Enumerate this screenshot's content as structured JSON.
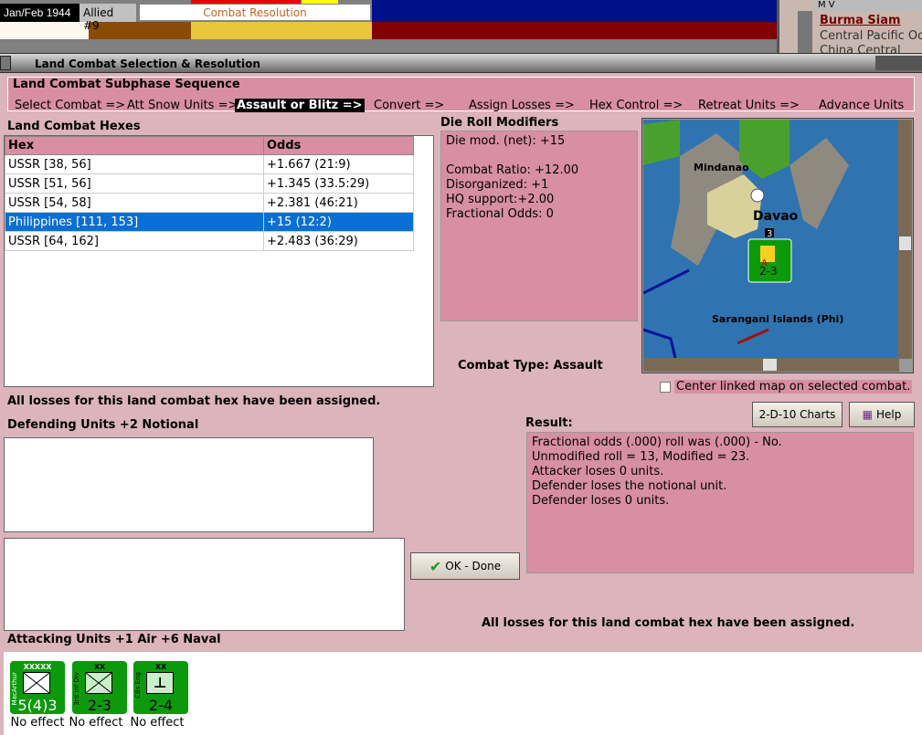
{
  "top": {
    "date": "Jan/Feb 1944",
    "side": "Allied #9",
    "phase": "Combat Resolution",
    "right_panel": {
      "header": "M V",
      "items": [
        "Burma Siam",
        "Central Pacific Oc",
        "China Central"
      ]
    }
  },
  "window": {
    "title": "Land Combat Selection & Resolution"
  },
  "sequence": {
    "title": "Land Combat Subphase Sequence",
    "items": [
      "Select Combat =>",
      "Att Snow Units =>",
      "Assault or Blitz =>",
      "Convert =>",
      "Assign Losses =>",
      "Hex Control =>",
      "Retreat Units =>",
      "Advance Units"
    ],
    "active_index": 2
  },
  "hexes": {
    "title": "Land Combat Hexes",
    "columns": [
      "Hex",
      "Odds"
    ],
    "rows": [
      [
        "USSR [38, 56]",
        "+1.667 (21:9)"
      ],
      [
        "USSR [51, 56]",
        "+1.345 (33.5:29)"
      ],
      [
        "USSR [54, 58]",
        "+2.381 (46:21)"
      ],
      [
        "Philippines [111, 153]",
        "+15 (12:2)"
      ],
      [
        "USSR [64, 162]",
        "+2.483 (36:29)"
      ]
    ],
    "selected_index": 3
  },
  "modifiers": {
    "title": "Die Roll Modifiers",
    "lines": [
      "Die mod. (net): +15",
      "",
      "Combat Ratio: +12.00",
      "Disorganized: +1",
      "HQ support:+2.00",
      "Fractional Odds: 0"
    ]
  },
  "map": {
    "labels": [
      "Mindanao",
      "Davao",
      "Sarangani Islands (Phi)"
    ],
    "unit_strength": "2-3",
    "stack_count": "3",
    "unit_marker": "A"
  },
  "combat_type": "Combat Type:  Assault",
  "center_checkbox": {
    "label": "Center linked map on selected combat.",
    "checked": false
  },
  "buttons": {
    "charts": "2-D-10 Charts",
    "help": "Help",
    "ok": "OK - Done"
  },
  "losses_msg": "All losses for this land combat hex have been assigned.",
  "defending": {
    "title": "Defending Units +2 Notional"
  },
  "result": {
    "title": "Result:",
    "lines": [
      "Fractional odds (.000) roll was (.000)  - No.",
      "Unmodified roll = 13, Modified = 23.",
      "Attacker loses 0 units.",
      "Defender loses the notional unit.",
      "Defender loses 0 units."
    ]
  },
  "attacking": {
    "title": "Attacking Units +1 Air +6 Naval",
    "units": [
      {
        "name": "MacArthur",
        "size": "XXXXX",
        "strength": "5(4)3",
        "effect": "No effect"
      },
      {
        "name": "3rd Inf Div",
        "size": "XX",
        "strength": "2-3",
        "effect": "No effect"
      },
      {
        "name": "CBs Eng",
        "size": "XX",
        "strength": "2-4",
        "effect": "No effect"
      }
    ]
  }
}
